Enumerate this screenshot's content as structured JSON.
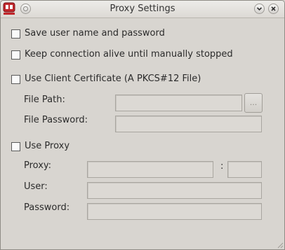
{
  "window": {
    "title": "Proxy Settings"
  },
  "options": {
    "save_credentials": "Save user name and password",
    "keep_alive": "Keep connection alive until manually stopped",
    "use_client_cert": "Use Client Certificate (A PKCS#12 File)",
    "use_proxy": "Use Proxy"
  },
  "certificate": {
    "file_path_label": "File Path:",
    "file_password_label": "File Password:",
    "browse_label": "..."
  },
  "proxy": {
    "proxy_label": "Proxy:",
    "port_separator": ":",
    "user_label": "User:",
    "password_label": "Password:"
  }
}
